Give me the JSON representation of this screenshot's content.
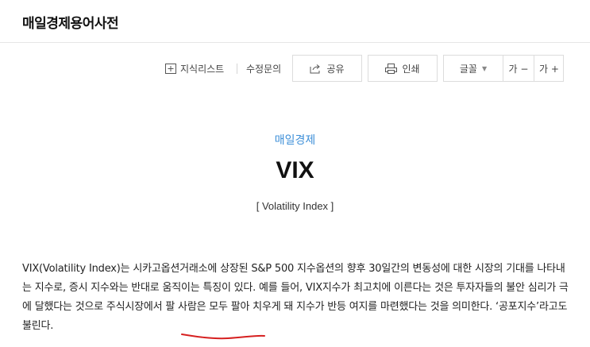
{
  "header": {
    "site_title": "매일경제용어사전"
  },
  "toolbar": {
    "wordlist_label": "지식리스트",
    "inquiry_label": "수정문의",
    "share_label": "공유",
    "print_label": "인쇄",
    "font_label": "글꼴",
    "font_decrease_label": "가 −",
    "font_increase_label": "가 +"
  },
  "entry": {
    "category": "매일경제",
    "term": "VIX",
    "term_en": "[ Volatility Index ]",
    "definition": "VIX(Volatility Index)는 시카고옵션거래소에 상장된 S&P 500 지수옵션의 향후 30일간의 변동성에 대한 시장의 기대를 나타내는 지수로, 증시 지수와는 반대로 움직이는 특징이 있다. 예를 들어, VIX지수가 최고치에 이른다는 것은 투자자들의 불안 심리가 극에 달했다는 것으로 주식시장에서 팔 사람은 모두 팔아 치우게 돼 지수가 반등 여지를 마련했다는 것을 의미한다. ‘공포지수’라고도 불린다."
  },
  "colors": {
    "accent": "#3d8fd8",
    "underline_mark": "#d62020"
  },
  "icons": {
    "wordlist": "plus-square-icon",
    "share": "share-icon",
    "print": "printer-icon",
    "font_caret": "caret-down-icon"
  }
}
